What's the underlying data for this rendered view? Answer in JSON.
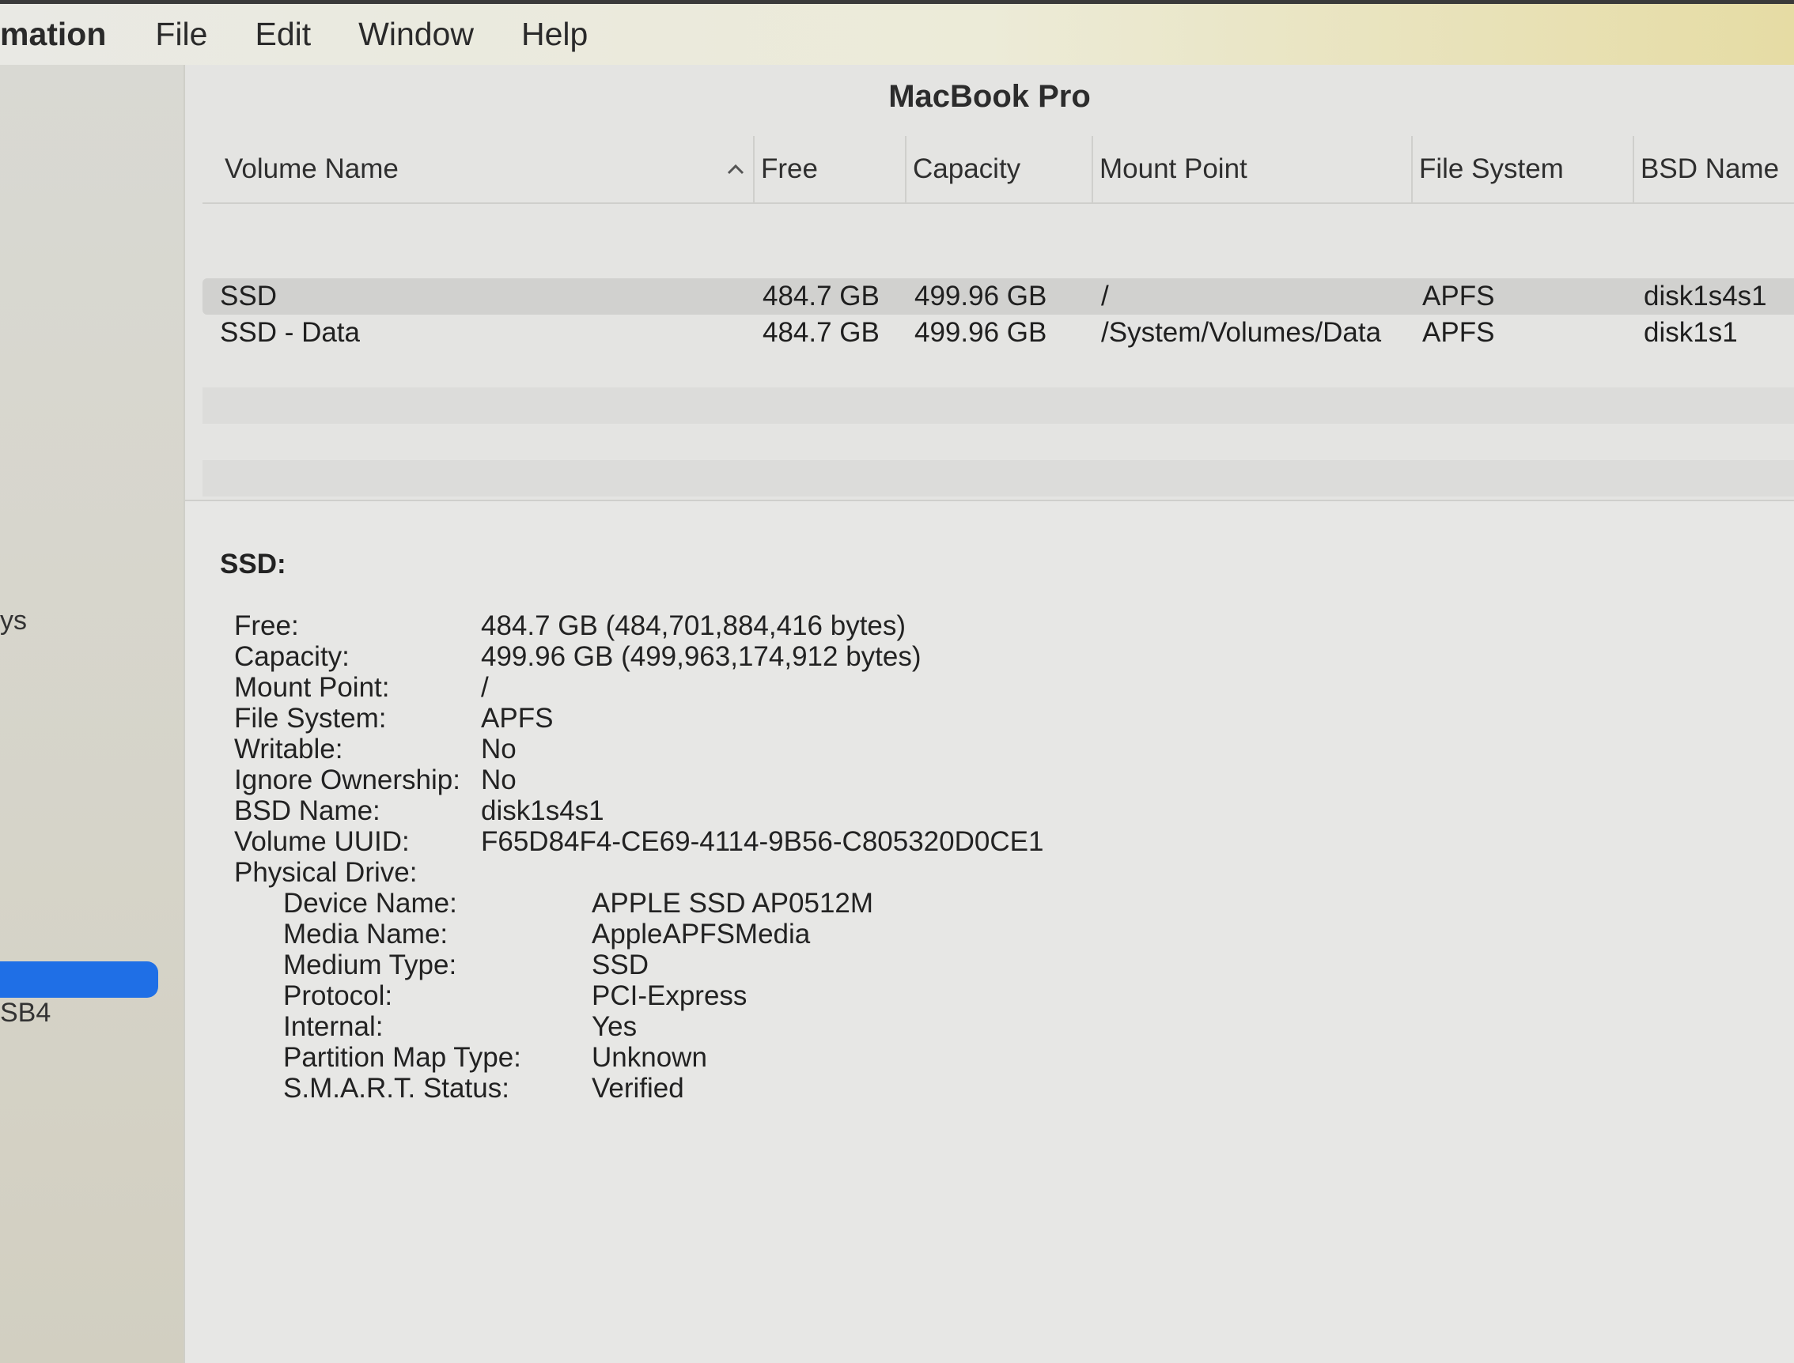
{
  "menubar": {
    "app": "mation",
    "items": [
      "File",
      "Edit",
      "Window",
      "Help"
    ]
  },
  "sidebar": {
    "texts": [
      "ys",
      "SB4"
    ],
    "selected_color": "#1f6fe6"
  },
  "window": {
    "title": "MacBook Pro"
  },
  "table": {
    "columns": [
      "Volume Name",
      "Free",
      "Capacity",
      "Mount Point",
      "File System",
      "BSD Name"
    ],
    "sort_icon": "chevron-up-icon",
    "rows": [
      {
        "name": "SSD",
        "free": "484.7 GB",
        "capacity": "499.96 GB",
        "mount": "/",
        "fs": "APFS",
        "bsd": "disk1s4s1"
      },
      {
        "name": "SSD - Data",
        "free": "484.7 GB",
        "capacity": "499.96 GB",
        "mount": "/System/Volumes/Data",
        "fs": "APFS",
        "bsd": "disk1s1"
      }
    ]
  },
  "detail": {
    "title": "SSD:",
    "fields": [
      {
        "label": "Free:",
        "value": "484.7 GB (484,701,884,416 bytes)"
      },
      {
        "label": "Capacity:",
        "value": "499.96 GB (499,963,174,912 bytes)"
      },
      {
        "label": "Mount Point:",
        "value": "/"
      },
      {
        "label": "File System:",
        "value": "APFS"
      },
      {
        "label": "Writable:",
        "value": "No"
      },
      {
        "label": "Ignore Ownership:",
        "value": "No"
      },
      {
        "label": "BSD Name:",
        "value": "disk1s4s1"
      },
      {
        "label": "Volume UUID:",
        "value": "F65D84F4-CE69-4114-9B56-C805320D0CE1"
      }
    ],
    "physical_drive_label": "Physical Drive:",
    "drive_fields": [
      {
        "label": "Device Name:",
        "value": "APPLE SSD AP0512M"
      },
      {
        "label": "Media Name:",
        "value": "AppleAPFSMedia"
      },
      {
        "label": "Medium Type:",
        "value": "SSD"
      },
      {
        "label": "Protocol:",
        "value": "PCI-Express"
      },
      {
        "label": "Internal:",
        "value": "Yes"
      },
      {
        "label": "Partition Map Type:",
        "value": "Unknown"
      },
      {
        "label": "S.M.A.R.T. Status:",
        "value": "Verified"
      }
    ]
  }
}
